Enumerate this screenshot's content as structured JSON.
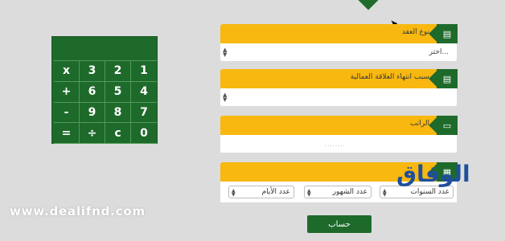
{
  "keypad": {
    "keys": [
      "x",
      "3",
      "2",
      "1",
      "+",
      "6",
      "5",
      "4",
      "-",
      "9",
      "8",
      "7",
      "=",
      "÷",
      "c",
      "0"
    ]
  },
  "form": {
    "contract_type": {
      "label": "نوع العقد",
      "value": "اختر..."
    },
    "termination_reason": {
      "label": "سبب انتهاء العلاقة العمالية",
      "value": ""
    },
    "salary": {
      "label": "الراتب",
      "placeholder": "........"
    },
    "service_duration": {
      "years_label": "عدد السنوات",
      "months_label": "عدد الشهور",
      "days_label": "عدد الأيام"
    },
    "calculate_label": "حساب"
  },
  "watermark": {
    "url": "www.dealifnd.com",
    "logo": "الوفاق"
  },
  "colors": {
    "green": "#1e6a2b",
    "yellow": "#f8b80f",
    "bg": "#dcdcdc"
  }
}
